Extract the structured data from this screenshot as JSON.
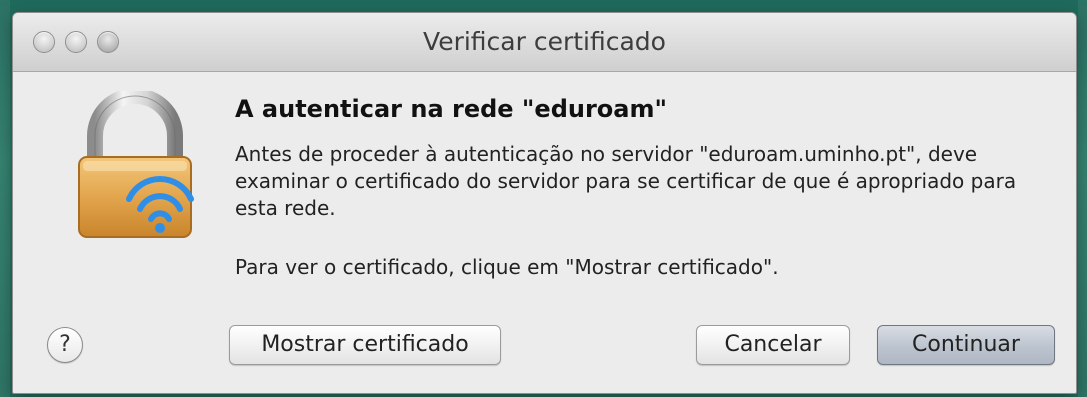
{
  "window": {
    "title": "Verificar certificado"
  },
  "dialog": {
    "heading": "A autenticar na rede \"eduroam\"",
    "description": "Antes de proceder à autenticação no servidor \"eduroam.uminho.pt\", deve examinar o certificado do servidor para se certificar de que é apropriado para esta rede.",
    "hint": "Para ver o certificado, clique em \"Mostrar certificado\"."
  },
  "buttons": {
    "help_label": "?",
    "show_certificate_label": "Mostrar certificado",
    "cancel_label": "Cancelar",
    "continue_label": "Continuar"
  },
  "icons": {
    "window_controls": [
      "close-icon",
      "minimize-icon",
      "zoom-icon"
    ],
    "dialog_icon": "wifi-lock-icon"
  }
}
